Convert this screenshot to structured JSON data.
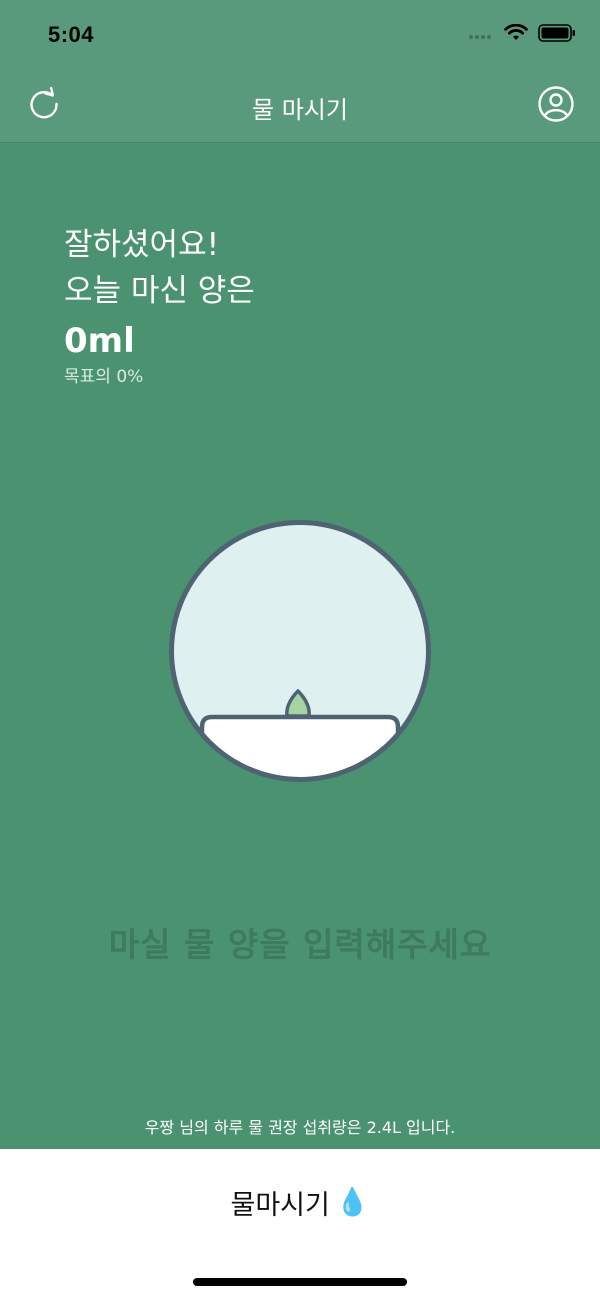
{
  "status_bar": {
    "time": "5:04",
    "icons": [
      "signal-icon",
      "wifi-icon",
      "battery-icon"
    ]
  },
  "nav": {
    "title": "물 마시기",
    "left_icon": "refresh-icon",
    "right_icon": "profile-icon"
  },
  "summary": {
    "line1": "잘하셨어요!",
    "line2": "오늘 마신 양은",
    "amount": "0ml",
    "goal_label": "목표의",
    "goal_percent": "0%"
  },
  "cup": {
    "fill_fraction": 0,
    "icon": "plant-sprout-icon"
  },
  "prompt": "마실 물 양을 입력해주세요",
  "recommendation": "우짱 님의 하루 물 권장 섭취량은 2.4L 입니다.",
  "drink_button": {
    "label": "물마시기",
    "emoji": "💧"
  },
  "colors": {
    "background": "#4a9270",
    "header": "#5a9a7c",
    "cup_inner": "#dff0f0",
    "cup_border": "#4e6472",
    "sprout": "#a6d3a3"
  }
}
